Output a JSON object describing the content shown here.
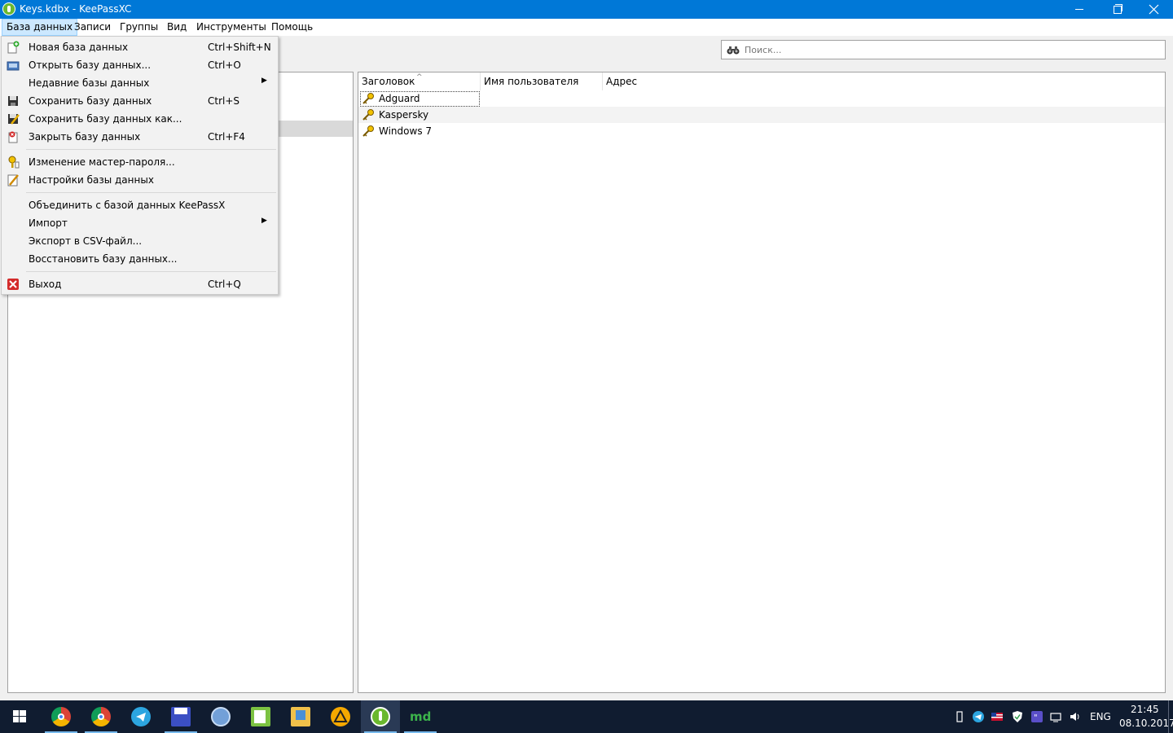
{
  "window": {
    "title": "Keys.kdbx - KeePassXC",
    "icon": "keepassxc-logo-icon"
  },
  "menubar": {
    "items": [
      {
        "label": "База данных",
        "active": true
      },
      {
        "label": "Записи"
      },
      {
        "label": "Группы"
      },
      {
        "label": "Вид"
      },
      {
        "label": "Инструменты"
      },
      {
        "label": "Помощь"
      }
    ]
  },
  "search": {
    "placeholder": "Поиск...",
    "value": "",
    "icon": "binoculars-icon"
  },
  "database_menu": {
    "items": [
      {
        "label": "Новая база данных",
        "shortcut": "Ctrl+Shift+N",
        "icon": "new-database-icon"
      },
      {
        "label": "Открыть базу данных...",
        "shortcut": "Ctrl+O",
        "icon": "open-database-icon"
      },
      {
        "label": "Недавние базы данных",
        "submenu": true
      },
      {
        "label": "Сохранить базу данных",
        "shortcut": "Ctrl+S",
        "icon": "save-icon"
      },
      {
        "label": "Сохранить базу данных как...",
        "icon": "save-as-icon"
      },
      {
        "label": "Закрыть базу данных",
        "shortcut": "Ctrl+F4",
        "icon": "close-database-icon"
      },
      {
        "label": "Изменение мастер-пароля...",
        "icon": "master-key-icon"
      },
      {
        "label": "Настройки базы данных",
        "icon": "database-settings-icon"
      },
      {
        "label": "Объединить с базой данных KeePassX"
      },
      {
        "label": "Импорт",
        "submenu": true
      },
      {
        "label": "Экспорт в CSV-файл..."
      },
      {
        "label": "Восстановить базу данных..."
      },
      {
        "label": "Выход",
        "shortcut": "Ctrl+Q",
        "icon": "exit-icon"
      }
    ]
  },
  "entries": {
    "columns": [
      "Заголовок",
      "Имя пользователя",
      "Адрес"
    ],
    "sorted_column": "Заголовок",
    "rows": [
      {
        "title": "Adguard",
        "username": "",
        "url": ""
      },
      {
        "title": "Kaspersky",
        "username": "",
        "url": ""
      },
      {
        "title": "Windows 7",
        "username": "",
        "url": ""
      }
    ]
  },
  "taskbar": {
    "apps": [
      "chrome-icon",
      "chrome-user-icon",
      "telegram-icon",
      "save-disk-icon",
      "qbittorrent-icon",
      "notepad-icon",
      "folder-icon",
      "aimp-icon",
      "keepassxc-icon",
      "markdown-icon"
    ],
    "tray": {
      "language": "ENG",
      "time": "21:45",
      "date": "08.10.2017"
    }
  },
  "colors": {
    "titlebar": "#0078d7",
    "taskbar": "#101c30",
    "menu_active": "#cce8ff",
    "selection": "#d9d9d9"
  }
}
